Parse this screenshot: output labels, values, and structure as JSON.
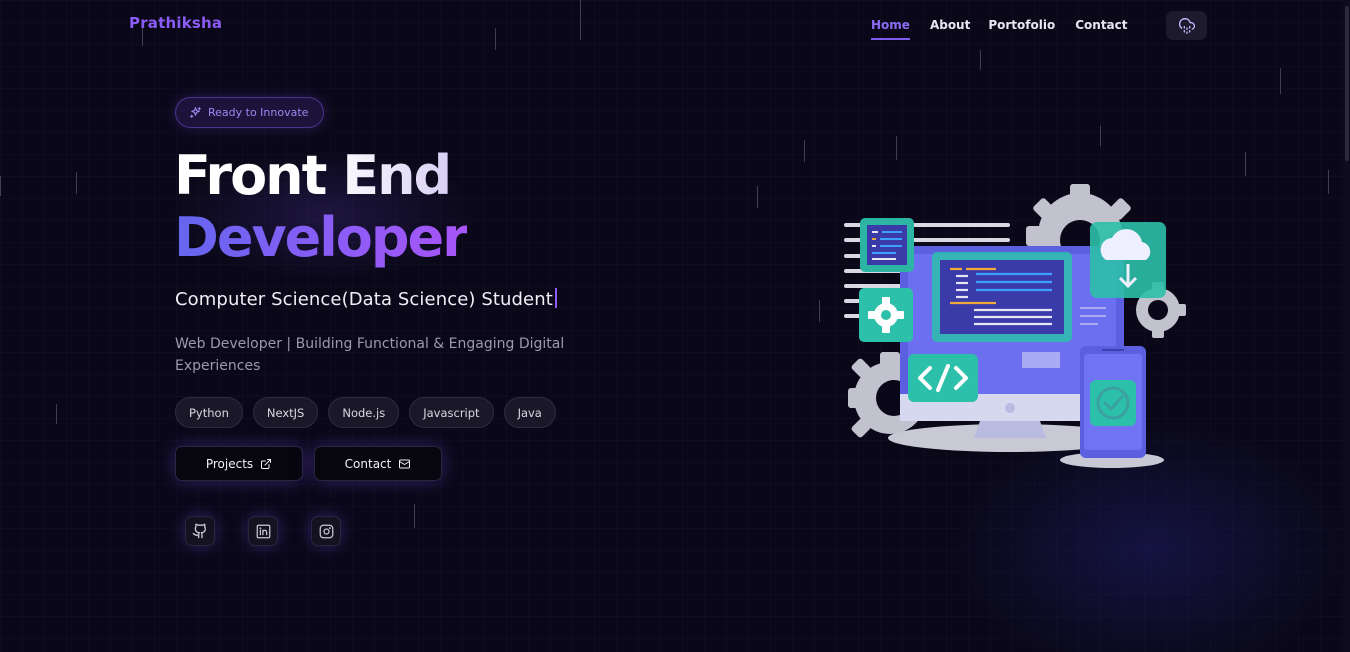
{
  "nav": {
    "logo": "Prathiksha",
    "links": [
      "Home",
      "About",
      "Portofolio",
      "Contact"
    ],
    "active": "Home",
    "theme_icon": "cloud-rain-icon"
  },
  "hero": {
    "badge": "Ready to Innovate",
    "badge_icon": "sparkles-icon",
    "title_line1": "Front End",
    "title_line2": "Developer",
    "subtitle": "Computer Science(Data Science) Student",
    "description": "Web Developer | Building Functional & Engaging Digital Experiences",
    "skills": [
      "Python",
      "NextJS",
      "Node.js",
      "Javascript",
      "Java"
    ],
    "buttons": {
      "projects": "Projects",
      "contact": "Contact"
    },
    "socials": [
      "github-icon",
      "linkedin-icon",
      "instagram-icon"
    ]
  },
  "colors": {
    "background": "#0a0818",
    "accent": "#8b5cf6",
    "accent_blue": "#6466f0"
  }
}
